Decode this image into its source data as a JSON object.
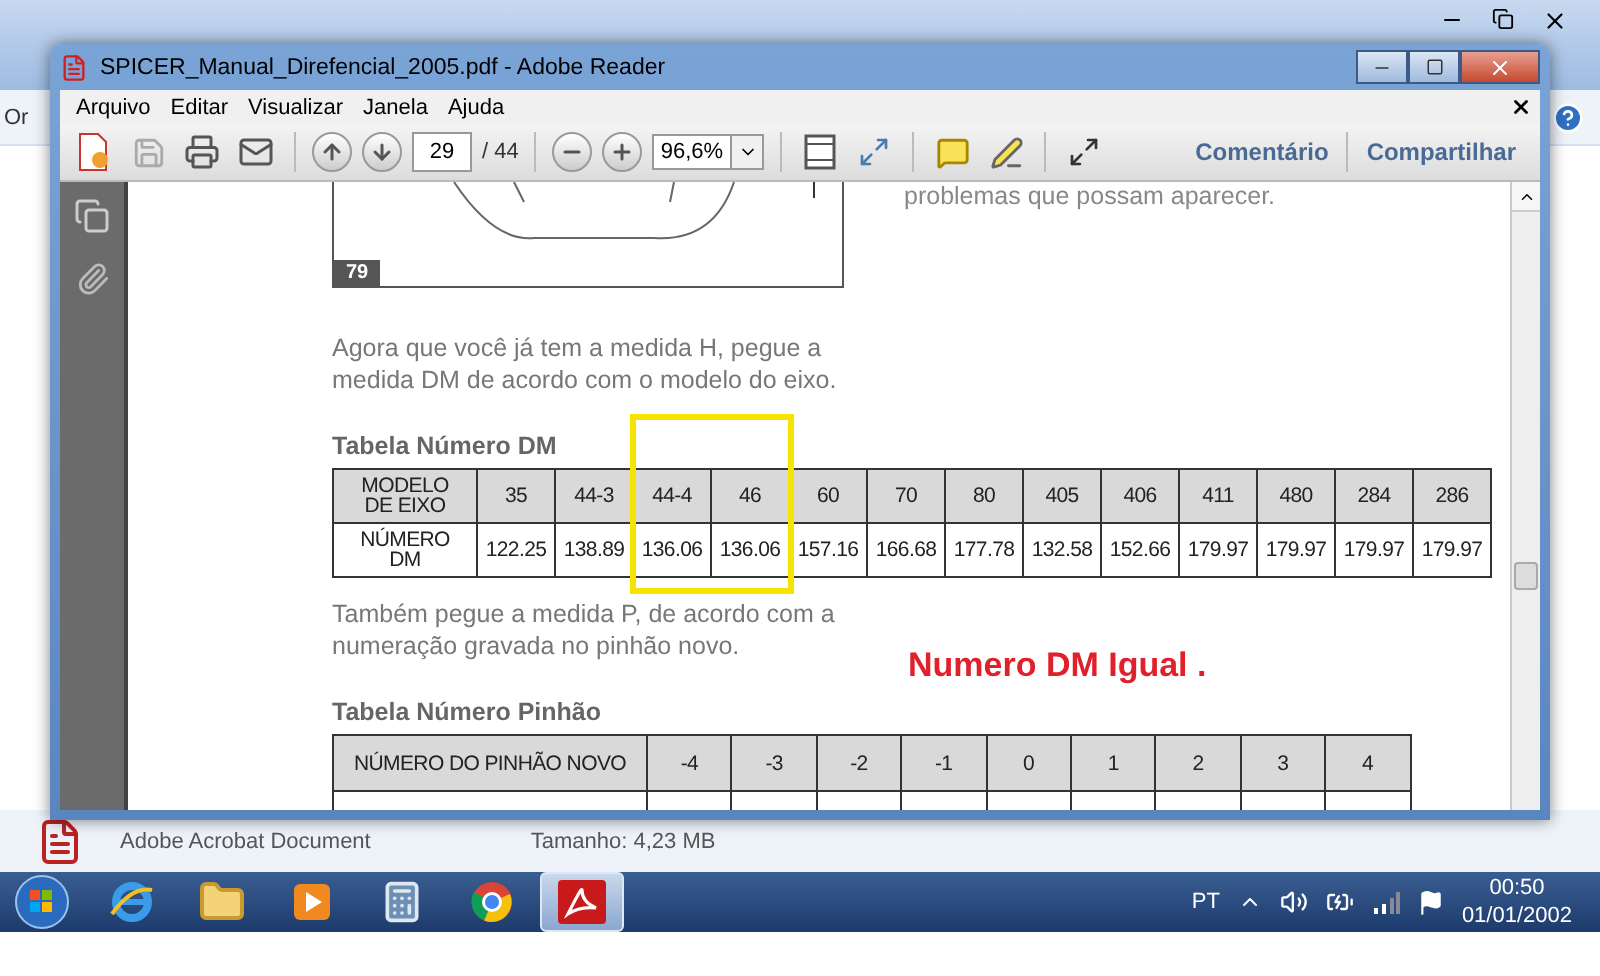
{
  "background_window": {
    "toolbar_text": "Or"
  },
  "reader": {
    "title": "SPICER_Manual_Direfencial_2005.pdf - Adobe Reader",
    "menu": [
      "Arquivo",
      "Editar",
      "Visualizar",
      "Janela",
      "Ajuda"
    ],
    "toolbar": {
      "page": "29",
      "page_total": "/ 44",
      "zoom": "96,6%",
      "comment": "Comentário",
      "share": "Compartilhar"
    },
    "document": {
      "figure_number": "79",
      "cut_text": "problemas que possam aparecer.",
      "paragraph_1": "Agora que você já tem a medida H, pegue a medida DM de acordo com o modelo do eixo.",
      "table_1": {
        "title": "Tabela Número DM",
        "row_labels": [
          "MODELO DE EIXO",
          "NÚMERO DM"
        ],
        "columns": [
          {
            "model": "35",
            "dm": "122.25",
            "highlighted": false
          },
          {
            "model": "44-3",
            "dm": "138.89",
            "highlighted": false
          },
          {
            "model": "44-4",
            "dm": "136.06",
            "highlighted": true
          },
          {
            "model": "46",
            "dm": "136.06",
            "highlighted": true
          },
          {
            "model": "60",
            "dm": "157.16",
            "highlighted": false
          },
          {
            "model": "70",
            "dm": "166.68",
            "highlighted": false
          },
          {
            "model": "80",
            "dm": "177.78",
            "highlighted": false
          },
          {
            "model": "405",
            "dm": "132.58",
            "highlighted": false
          },
          {
            "model": "406",
            "dm": "152.66",
            "highlighted": false
          },
          {
            "model": "411",
            "dm": "179.97",
            "highlighted": false
          },
          {
            "model": "480",
            "dm": "179.97",
            "highlighted": false
          },
          {
            "model": "284",
            "dm": "179.97",
            "highlighted": false
          },
          {
            "model": "286",
            "dm": "179.97",
            "highlighted": false
          }
        ]
      },
      "paragraph_2": "Também pegue a medida P, de acordo com a numeração gravada no pinhão novo.",
      "annotation": "Numero DM Igual .",
      "table_2": {
        "title": "Tabela Número Pinhão",
        "row_label": "NÚMERO DO PINHÃO NOVO",
        "values": [
          "-4",
          "-3",
          "-2",
          "-1",
          "0",
          "1",
          "2",
          "3",
          "4"
        ]
      }
    }
  },
  "details_pane": {
    "file_type": "Adobe Acrobat Document",
    "size": "Tamanho: 4,23 MB"
  },
  "taskbar": {
    "apps": [
      {
        "kind": "browser-e",
        "selected": false
      },
      {
        "kind": "folder",
        "selected": false
      },
      {
        "kind": "media",
        "selected": false
      },
      {
        "kind": "calculator",
        "selected": false
      },
      {
        "kind": "browser-wheel",
        "selected": false
      },
      {
        "kind": "pdf",
        "selected": true
      }
    ],
    "language": "PT",
    "time": "00:50",
    "date": "01/01/2002"
  }
}
